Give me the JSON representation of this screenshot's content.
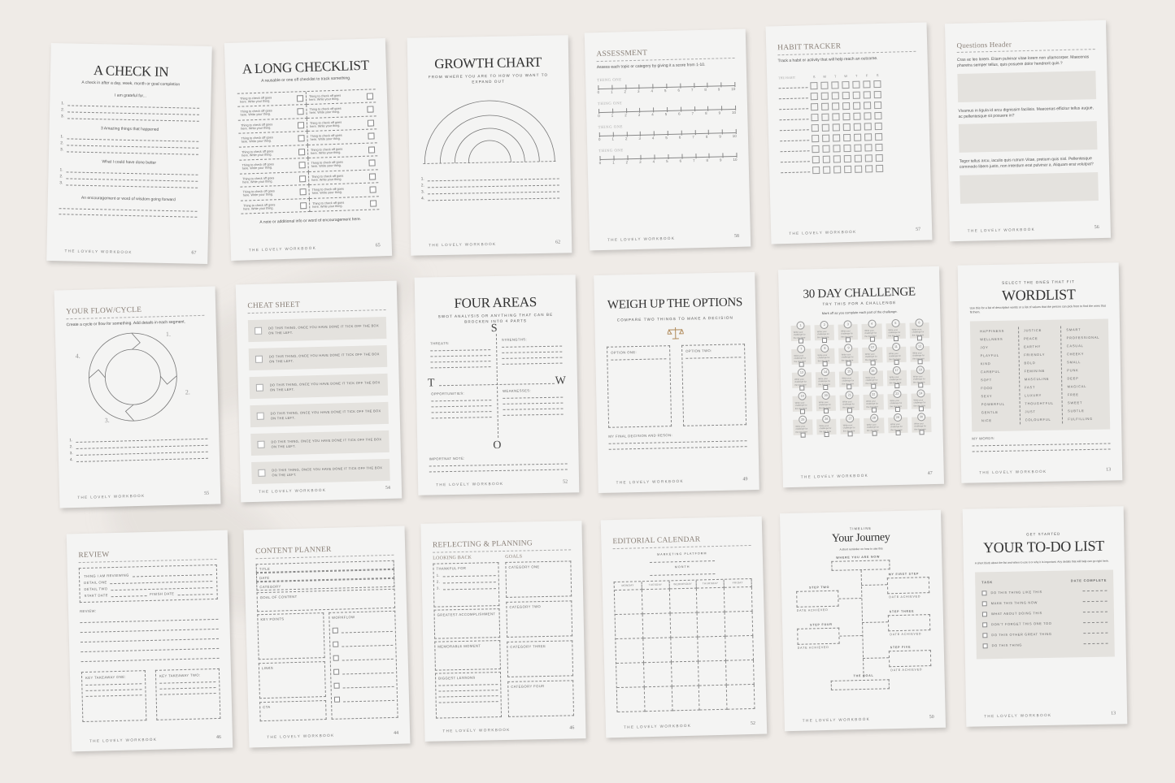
{
  "brand": "THE LOVELY WORKBOOK",
  "colors": {
    "background": "#efebe7",
    "page": "#f4f4f3",
    "panel": "#e4e2de",
    "accent": "#8a8078",
    "scale_icon": "#b08a5a"
  },
  "pages": {
    "check_in": {
      "title": "A CHECK IN",
      "subtitle": "A check in after a day, week, month or goal completion",
      "sections": [
        "I am grateful for...",
        "3 Amazing things that happened",
        "What I could have done better"
      ],
      "numbers": [
        "1.",
        "2.",
        "3."
      ],
      "closing": "An encouragement or word of wisdom going forward",
      "page_number": "67"
    },
    "long_checklist": {
      "title": "A LONG CHECKLIST",
      "subtitle": "A reusable or one off checklist to track something.",
      "item_text": "Thing to check off goes here. Write your thing.",
      "item_count": 18,
      "note": "A note or additional info or word of encouragement here.",
      "page_number": "65"
    },
    "growth_chart": {
      "title": "GROWTH CHART",
      "subtitle": "FROM WHERE YOU ARE TO HOW YOU WANT TO EXPAND OUT",
      "numbers": [
        "1.",
        "2.",
        "3.",
        "4."
      ],
      "page_number": "62"
    },
    "assessment": {
      "title": "ASSESSMENT",
      "subtitle": "Assess each topic or category by giving it a score from 1-10.",
      "things": [
        "THING ONE",
        "THING ONE",
        "THING ONE",
        "THING ONE"
      ],
      "scale": [
        "0",
        "1",
        "2",
        "3",
        "4",
        "5",
        "6",
        "7",
        "8",
        "9",
        "10"
      ],
      "page_number": "58"
    },
    "habit_tracker": {
      "title": "HABIT TRACKER",
      "subtitle": "Track a habit or activity that will help reach an outcome.",
      "habit_label": "THE HABIT",
      "days": [
        "S",
        "M",
        "T",
        "W",
        "T",
        "F",
        "S"
      ],
      "rows": 9,
      "page_number": "57"
    },
    "questions": {
      "title": "Questions Header",
      "questions": [
        "Cras ac leo lorem. Etiam pulvinar vitae lorem non ullamcorper. Maecenas pharetra semper tellus, quis posuere dolor hendrerit quis.?",
        "Vivamus in ligula id arcu dignissim facilisis. Maecenas efficitur tellus augue, ac pellentesque sit posuere in?",
        "Tegor tellus arcu, iaculis quis rutrum Vitae, pretium quis nisl. Pellentesque commodo libero justo, non interdum erat pulvinar a. Aliquam erat volutpat?"
      ],
      "page_number": "56"
    },
    "flow_cycle": {
      "title": "YOUR FLOW/CYCLE",
      "subtitle": "Create a cycle or flow for something. Add details in each segment.",
      "segments": [
        "1.",
        "2.",
        "3.",
        "4."
      ],
      "numbers": [
        "1.",
        "2.",
        "3.",
        "4."
      ],
      "page_number": "55"
    },
    "cheat_sheet": {
      "title": "CHEAT SHEET",
      "items": [
        "DO THIS THING, ONCE YOU HAVE DONE IT TICK OFF THE BOX ON THE LEFT.",
        "DO THIS THING, ONCE YOU HAVE DONE IT TICK OFF THE BOX ON THE LEFT.",
        "DO THIS THING, ONCE YOU HAVE DONE IT TICK OFF THE BOX ON THE LEFT.",
        "DO THIS THING, ONCE YOU HAVE DONE IT TICK OFF THE BOX ON THE LEFT.",
        "DO THIS THING, ONCE YOU HAVE DONE IT TICK OFF THE BOX ON THE LEFT.",
        "DO THIS THING, ONCE YOU HAVE DONE IT TICK OFF THE BOX ON THE LEFT."
      ],
      "page_number": "54"
    },
    "four_areas": {
      "title": "FOUR AREAS",
      "subtitle": "SWOT ANALYSIS OR ANYTHING THAT CAN BE BROCKEN INTO 4 PARTS",
      "letters": {
        "s": "S",
        "w": "W",
        "o": "O",
        "t": "T"
      },
      "labels": {
        "threats": "THREATS:",
        "strengths": "STRENGTHS:",
        "opportunities": "OPPORTUNITIES:",
        "weaknesses": "WEAKNESSES:"
      },
      "note_label": "IMPORTNAT NOTE:",
      "page_number": "52"
    },
    "weigh_options": {
      "title": "WEIGH UP THE OPTIONS",
      "subtitle": "COMPARE TWO THINGS TO MAKE A DECISION",
      "option_one": "OPTION ONE:",
      "option_two": "OPTION TWO:",
      "decision_label": "MY FINAL DECISION AND RESON:",
      "page_number": "49"
    },
    "challenge": {
      "title": "30 DAY CHALLENGE",
      "subtitle": "TRY THIS FOR A CHALLENGE",
      "instruction": "Mark off as you complete each part of the challenge.",
      "day_text": "Write your challenge for the day here",
      "days": [
        "1",
        "2",
        "3",
        "4",
        "5",
        "6",
        "7",
        "8",
        "9",
        "10",
        "11",
        "12",
        "13",
        "14",
        "15",
        "16",
        "17",
        "18",
        "19",
        "20",
        "21",
        "22",
        "23",
        "24",
        "25",
        "26",
        "27",
        "28",
        "29",
        "30"
      ],
      "page_number": "47"
    },
    "wordlist": {
      "kicker": "SELECT THE ONES THAT FIT",
      "title": "WORDLIST",
      "subtitle": "Use this for a list of descriptive words or a list of values that the person can pick from to find the ones that fit them.",
      "columns": [
        [
          "HAPPINESS",
          "WELLNESS",
          "JOY",
          "PLAYFUL",
          "KIND",
          "CAREFUL",
          "SOFT",
          "FOOD",
          "SEXY",
          "POWERFUL",
          "GENTLE",
          "NICE"
        ],
        [
          "JUSTICE",
          "PEACE",
          "EARTHY",
          "FRIENDLY",
          "BOLD",
          "FEMININE",
          "MASCULINE",
          "FAST",
          "LUXURY",
          "THOUGHTFUL",
          "JUST",
          "COLOURFUL"
        ],
        [
          "SMART",
          "PROFESSIONAL",
          "CASUAL",
          "CHEEKY",
          "SMALL",
          "PUNK",
          "DEEP",
          "MAGICAL",
          "FREE",
          "SWEET",
          "SUBTLE",
          "FULFILLING"
        ]
      ],
      "my_words": "MY WORDS:",
      "page_number": "13"
    },
    "review": {
      "title": "REVIEW",
      "fields": [
        "THING I AM REVIEWING",
        "DETAIL ONE",
        "DETAIL TWO"
      ],
      "start_date": "START DATE",
      "finish_date": "FINISH DATE",
      "review_label": "REVIEW:",
      "takeaway_one": "KEY TAKEAWAY ONE:",
      "takeaway_two": "KEY TAKEAWAY TWO:",
      "page_number": "46"
    },
    "content_planner": {
      "title": "CONTENT PLANNER",
      "fields": [
        "TITLE",
        "DATE",
        "CATEGORY"
      ],
      "goal": "GOAL OF CONTENT",
      "key_points": "KEY POINTS",
      "workflow": "WORKFLOW",
      "links": "LINKS",
      "cta": "CTA",
      "page_number": "44"
    },
    "reflecting": {
      "title": "REFLECTING & PLANNING",
      "looking_back": "LOOKING BACK",
      "goals": "GOALS",
      "thankful": "THANKFUL FOR",
      "numbers": [
        "1.",
        "2.",
        "3."
      ],
      "accomplishment": "GREATEST ACCOMPLISHMENT",
      "memorable": "MEMORABLE MOMENT",
      "lessons": "BIGGEST LESSONS",
      "categories": [
        "CATEGORY ONE",
        "CATEGORY TWO",
        "CATEGORY THREE",
        "CATEGORY FOUR"
      ],
      "page_number": "46"
    },
    "editorial": {
      "title": "EDITORIAL CALENDAR",
      "platform": "MARKETING PLATFORM",
      "month": "MONTH",
      "weekdays": [
        "MONDAY",
        "TUESDAY",
        "WEDNESDAY",
        "THURSDAY",
        "FRIDAY"
      ],
      "page_number": "52"
    },
    "journey": {
      "kicker": "TIMELINE",
      "title": "Your Journey",
      "subtitle": "A short reminder on how to use this",
      "now": "WHERE YOU ARE NOW",
      "steps": [
        "MY FIRST STEP",
        "STEP TWO",
        "STEP THREE",
        "STEP FOUR",
        "STEP FIVE"
      ],
      "date_achieved": "DATE ACHIEVED",
      "goal": "THE GOAL",
      "page_number": "50"
    },
    "todo": {
      "kicker": "GET STARTED",
      "title": "YOUR TO-DO LIST",
      "subtitle": "A short blurb about the list and when to use it or why it is important. Any details that will help can go right here.",
      "task_header": "TASK",
      "date_header": "DATE COMPLETE",
      "tasks": [
        "DO THIS THING LIKE THIS",
        "MAKE THIS THING NOW",
        "WHAT ABOUT DOING THIS",
        "DON'T FORGET THIS ONE TOO",
        "DO THIS OTHER GREAT THING",
        "DO THIS THING"
      ],
      "page_number": "13"
    }
  }
}
